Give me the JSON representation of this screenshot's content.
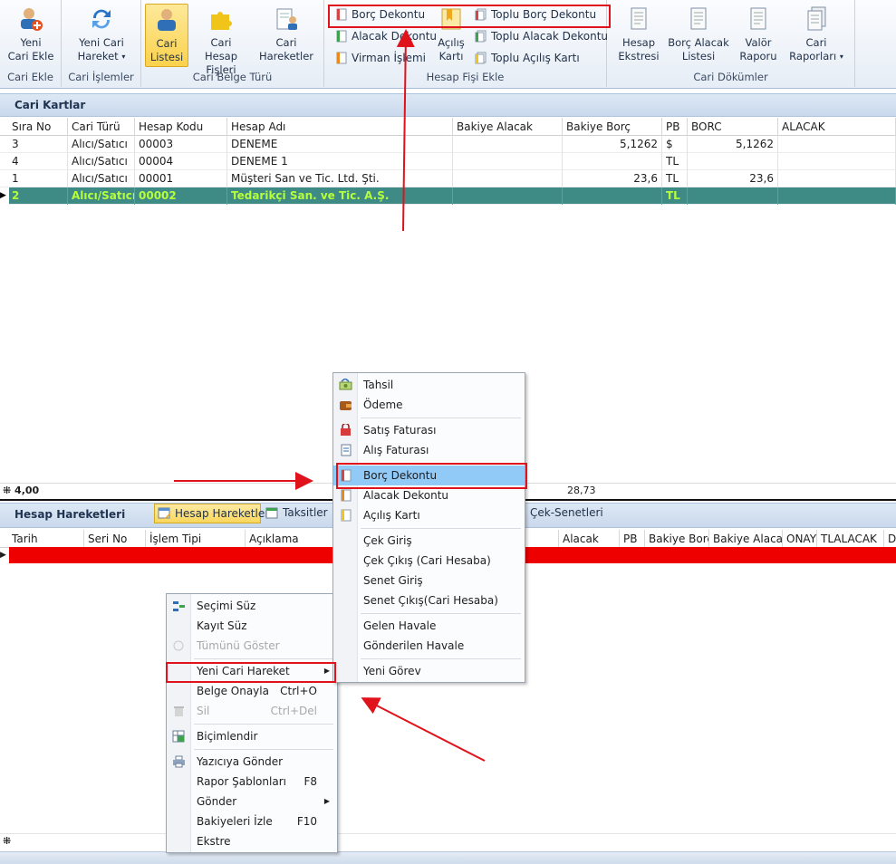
{
  "ribbon": {
    "groups": {
      "cari_ekle": "Cari Ekle",
      "cari_islemler": "Cari İşlemler",
      "cari_belge_turu": "Cari Belge Türü",
      "hesap_fisi_ekle": "Hesap Fişi Ekle",
      "cari_dokumler": "Cari Dökümler"
    },
    "yeni_cari_ekle": [
      "Yeni",
      "Cari Ekle"
    ],
    "yeni_cari_hareket": [
      "Yeni Cari",
      "Hareket"
    ],
    "cari_listesi": [
      "Cari",
      "Listesi"
    ],
    "cari_hesap_fisleri": [
      "Cari Hesap",
      "Fişleri"
    ],
    "cari_hareketler": [
      "Cari",
      "Hareketler"
    ],
    "borc_dekontu": "Borç Dekontu",
    "alacak_dekontu": "Alacak Dekontu",
    "virman_islemi": "Virman İşlemi",
    "acilis_karti": [
      "Açılış",
      "Kartı"
    ],
    "toplu_borc_dekontu": "Toplu Borç Dekontu",
    "toplu_alacak_dekontu": "Toplu Alacak Dekontu",
    "toplu_acilis_karti": "Toplu Açılış Kartı",
    "hesap_ekstresi": [
      "Hesap",
      "Ekstresi"
    ],
    "borc_alacak_listesi": [
      "Borç Alacak",
      "Listesi"
    ],
    "valor_raporu": [
      "Valör",
      "Raporu"
    ],
    "cari_raporlari": [
      "Cari",
      "Raporları"
    ]
  },
  "cari_kartlar": {
    "title": "Cari Kartlar",
    "columns": [
      "Sıra No",
      "Cari Türü",
      "Hesap Kodu",
      "Hesap Adı",
      "Bakiye Alacak",
      "Bakiye Borç",
      "PB",
      "BORC",
      "ALACAK"
    ],
    "rows": [
      [
        "3",
        "Alıcı/Satıcı",
        "00003",
        "DENEME",
        "",
        "5,1262",
        "$",
        "5,1262",
        ""
      ],
      [
        "4",
        "Alıcı/Satıcı",
        "00004",
        "DENEME 1",
        "",
        "",
        "TL",
        "",
        ""
      ],
      [
        "1",
        "Alıcı/Satıcı",
        "00001",
        "Müşteri San ve Tic. Ltd. Şti.",
        "",
        "23,6",
        "TL",
        "23,6",
        ""
      ],
      [
        "2",
        "Alıcı/Satıcı",
        "00002",
        "Tedarikçi San. ve Tic. A.Ş.",
        "",
        "",
        "TL",
        "",
        ""
      ]
    ],
    "footer_count": "4,00",
    "footer_total": "28,73"
  },
  "hesap_hareketleri": {
    "title": "Hesap Hareketleri",
    "tab_hesap_hareketleri": "Hesap Hareketleri",
    "tab_taksitler": "Taksitler",
    "tab_cek_senetleri": "Çek-Senetleri",
    "columns": [
      "Tarih",
      "Seri No",
      "İşlem Tipi",
      "Açıklama",
      "Alacak",
      "PB",
      "Bakiye Borç",
      "Bakiye Alacak",
      "ONAY",
      "TLALACAK",
      "D"
    ]
  },
  "submenu": {
    "items": [
      "Tahsil",
      "Ödeme",
      "Satış Faturası",
      "Alış Faturası",
      "Borç Dekontu",
      "Alacak Dekontu",
      "Açılış Kartı",
      "Çek Giriş",
      "Çek Çıkış (Cari Hesaba)",
      "Senet Giriş",
      "Senet Çıkış(Cari Hesaba)",
      "Gelen Havale",
      "Gönderilen Havale",
      "Yeni Görev"
    ]
  },
  "context_menu": {
    "items": [
      "Seçimi Süz",
      "Kayıt Süz",
      "Tümünü Göster",
      "Yeni Cari Hareket",
      "Belge Onayla",
      "Sil",
      "Biçimlendir",
      "Yazıcıya Gönder",
      "Rapor Şablonları",
      "Gönder",
      "Bakiyeleri İzle",
      "Ekstre"
    ],
    "shortcuts": {
      "belge_onayla": "Ctrl+O",
      "sil": "Ctrl+Del",
      "rapor_sablonlari": "F8",
      "bakiyeleri_izle": "F10"
    }
  },
  "colors": {
    "selected_row_bg": "#3e8a84",
    "selected_row_text": "#b6ff3c",
    "highlight": "#91c9f7",
    "annotation_red": "#e0121c",
    "error_row": "#ee0000"
  }
}
